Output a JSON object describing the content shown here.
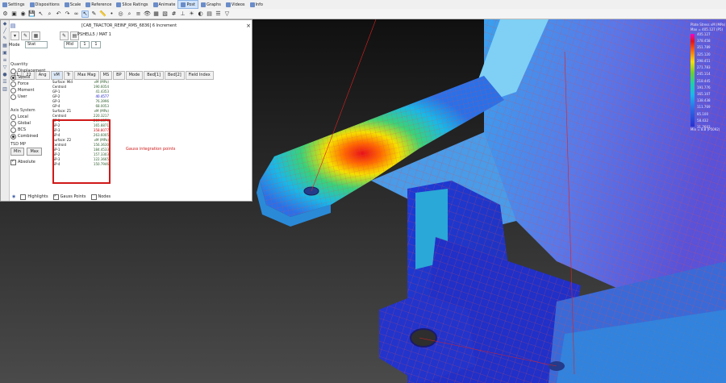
{
  "menubar": {
    "items": [
      "Settings",
      "Dispositions",
      "Scale",
      "Reference",
      "Slice Ratings",
      "Animate",
      "Post",
      "Graphs",
      "Videos",
      "Info"
    ],
    "active_index": 6
  },
  "toolbar": {
    "icons": [
      "settings-icon",
      "cube-icon",
      "camera-icon",
      "save-icon",
      "select-icon",
      "zoom-icon",
      "undo-icon",
      "redo-icon",
      "link-icon",
      "cursor-icon",
      "pen-icon",
      "ruler-icon",
      "node-icon",
      "target-icon",
      "search-icon",
      "layers-icon",
      "eye-icon",
      "grid-icon",
      "fill-icon",
      "mesh-icon",
      "axis-icon",
      "light-icon",
      "color-icon",
      "panel-icon",
      "list-icon",
      "filter-icon"
    ]
  },
  "panel": {
    "title": "[CAB_TRACTOR_REINF_RMS_6836] 6 Increment",
    "close_label": "×",
    "property_label": "PSHELL5 / MAT 1",
    "mode_label": "Mode",
    "mode_value": "Stat",
    "mode_field": "Mid",
    "mode_spin_1": "1",
    "mode_spin_2": "1",
    "quantity_label": "Quantity",
    "quantities": [
      "Displacement",
      "Stress",
      "Force",
      "Moment",
      "User"
    ],
    "quantity_selected": 1,
    "system_label": "Axis System",
    "systems": [
      "Local",
      "Global",
      "BCS",
      "Combined"
    ],
    "system_selected": 3,
    "tsd_label": "TSD MP",
    "btn_min": "Min",
    "btn_max": "Max",
    "absolute_label": "Absolute",
    "tabs": [
      "11",
      "22",
      "Ang",
      "vM",
      "Tr",
      "Max Mag",
      "MS",
      "BP",
      "Mode",
      "Bed[1]",
      "Bed[2]",
      "Field Index"
    ],
    "tab_active": 3,
    "bottom_items": [
      "Highlights",
      "Gauss Points",
      "Nodes"
    ],
    "annotation": "Gauss integration points",
    "results": [
      {
        "k": "Surface: Mid",
        "v": "vM (MPa)"
      },
      {
        "k": "Centroid",
        "v": "190.6054"
      },
      {
        "k": "GP-1",
        "v": "41.4353"
      },
      {
        "k": "GP-2",
        "v": "40.4577",
        "cls": "bl"
      },
      {
        "k": "GP-3",
        "v": "76.3996"
      },
      {
        "k": "GP-4",
        "v": "68.0053"
      },
      {
        "k": "Surface: Z1",
        "v": "vM (MPa)"
      },
      {
        "k": "Centroid",
        "v": "220.3217"
      },
      {
        "k": "GP-1",
        "v": "209.0576"
      },
      {
        "k": "GP-2",
        "v": "165.8871"
      },
      {
        "k": "GP-3",
        "v": "358.8077",
        "cls": "hl"
      },
      {
        "k": "GP-4",
        "v": "263.6005"
      },
      {
        "k": "Surface: Z2",
        "v": "vM (MPa)"
      },
      {
        "k": "Centroid",
        "v": "156.3630"
      },
      {
        "k": "GP-1",
        "v": "184.4533"
      },
      {
        "k": "GP-2",
        "v": "157.3303"
      },
      {
        "k": "GP-3",
        "v": "122.3665"
      },
      {
        "k": "GP-4",
        "v": "150.7946"
      }
    ]
  },
  "legend": {
    "title": "Plate Stress vM (MPa)",
    "subtitle": "Max = 405.127 (P5)",
    "labels": [
      "405.127",
      "378.458",
      "351.789",
      "325.120",
      "298.451",
      "271.783",
      "245.114",
      "218.445",
      "191.776",
      "165.107",
      "138.438",
      "111.769",
      "85.100",
      "58.432",
      "31.7603"
    ],
    "min_label": "Min = 8.8 (P5092)"
  },
  "colors": {
    "accent": "#cfe3fa",
    "highlight_red": "#d01818",
    "background": "#1e1e1e"
  }
}
